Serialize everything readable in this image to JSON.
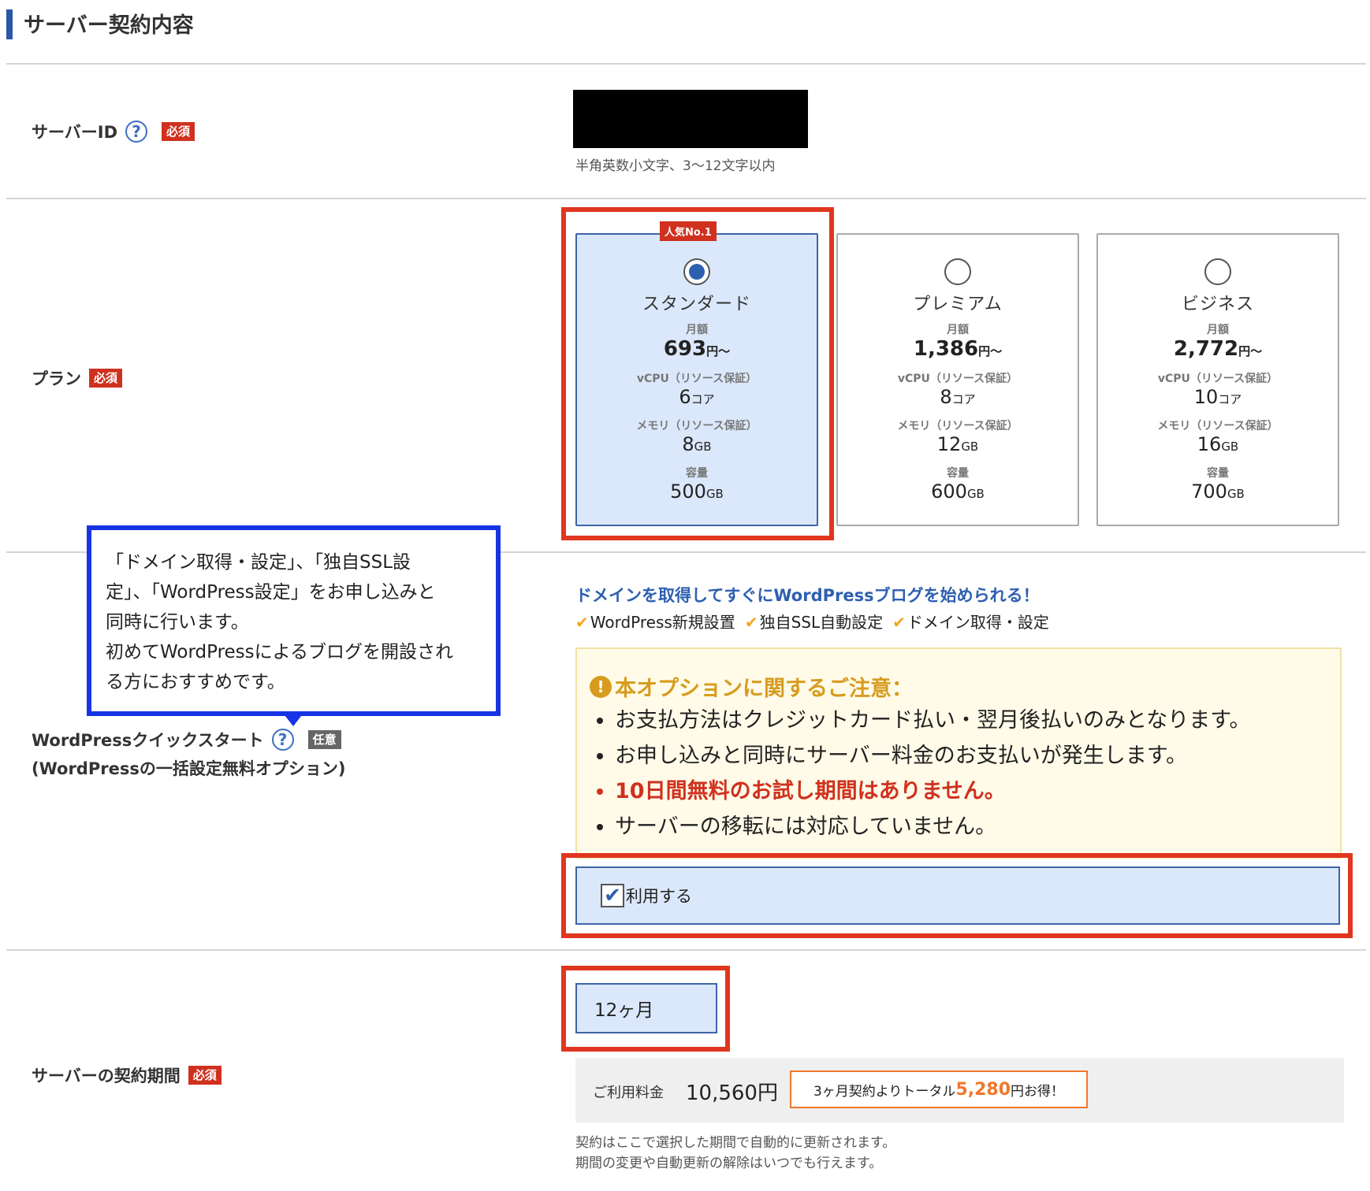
{
  "page_title": "サーバー契約内容",
  "server_id": {
    "label": "サーバーID",
    "help_icon": "?",
    "required_badge": "必須",
    "hint": "半角英数小文字、3〜12文字以内"
  },
  "plan": {
    "label": "プラン",
    "required_badge": "必須",
    "popular_badge": "人気No.1",
    "price_label": "月額",
    "vcpu_label": "vCPU（リソース保証）",
    "memory_label": "メモリ（リソース保証）",
    "storage_label": "容量",
    "price_unit": "円〜",
    "vcpu_unit": "コア",
    "gb_unit": "GB",
    "cards": [
      {
        "name": "スタンダード",
        "price": "693",
        "vcpu": "6",
        "memory": "8",
        "storage": "500",
        "selected": true
      },
      {
        "name": "プレミアム",
        "price": "1,386",
        "vcpu": "8",
        "memory": "12",
        "storage": "600",
        "selected": false
      },
      {
        "name": "ビジネス",
        "price": "2,772",
        "vcpu": "10",
        "memory": "16",
        "storage": "700",
        "selected": false
      }
    ]
  },
  "callout": {
    "lines": [
      "「ドメイン取得・設定」、「独自SSL設",
      "定」、「WordPress設定」をお申し込みと",
      "同時に行います。",
      "初めてWordPressによるブログを開設され",
      "る方におすすめです。"
    ]
  },
  "wp_quickstart": {
    "label": "WordPressクイックスタート",
    "help_icon": "?",
    "optional_badge": "任意",
    "sub_label": "(WordPressの一括設定無料オプション)",
    "lead": "ドメインを取得してすぐにWordPressブログを始められる！",
    "features": [
      "WordPress新規設置",
      "独自SSL自動設定",
      "ドメイン取得・設定"
    ],
    "notice_icon": "!",
    "notice_title": "本オプションに関するご注意：",
    "notice_items": [
      "お支払方法はクレジットカード払い・翌月後払いのみとなります。",
      "お申し込みと同時にサーバー料金のお支払いが発生します。",
      "10日間無料のお試し期間はありません。",
      "サーバーの移転には対応していません。"
    ],
    "use_label": "利用する",
    "use_checked": true
  },
  "contract": {
    "label": "サーバーの契約期間",
    "required_badge": "必須",
    "selected_period": "12ヶ月",
    "fee_label": "ご利用料金",
    "fee_value": "10,560円",
    "discount_prefix": "3ヶ月契約よりトータル",
    "discount_amount": "5,280",
    "discount_suffix": "円お得！",
    "footnote_1": "契約はここで選択した期間で自動的に更新されます。",
    "footnote_2": "期間の変更や自動更新の解除はいつでも行えます。"
  },
  "colors": {
    "accent": "#2b57a8",
    "required": "#d0311f",
    "highlight_box": "#e0361f",
    "callout_box": "#1634e6",
    "warning": "#d79c1e",
    "discount": "#f0782a"
  }
}
